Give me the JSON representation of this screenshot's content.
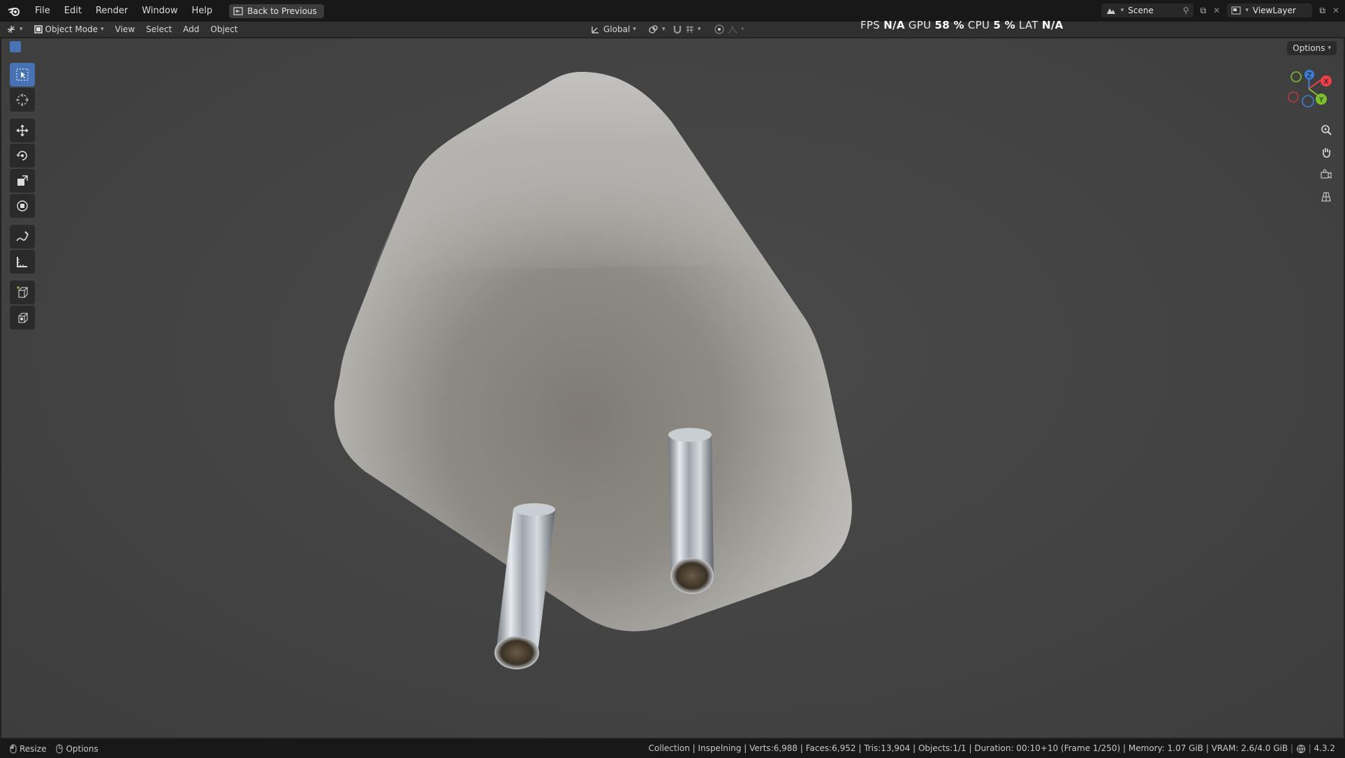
{
  "menubar": {
    "items": [
      "File",
      "Edit",
      "Render",
      "Window",
      "Help"
    ],
    "back_button": "Back to Previous",
    "scene_name": "Scene",
    "view_layer": "ViewLayer"
  },
  "header": {
    "mode": "Object Mode",
    "menus": [
      "View",
      "Select",
      "Add",
      "Object"
    ],
    "orientation": "Global",
    "options_label": "Options",
    "stats": {
      "fps_label": "FPS",
      "fps_value": "N/A",
      "gpu_label": "GPU",
      "gpu_value": "58 %",
      "cpu_label": "CPU",
      "cpu_value": "5 %",
      "lat_label": "LAT",
      "lat_value": "N/A"
    }
  },
  "toolbar": {
    "tools": [
      "select-box-icon",
      "cursor-icon",
      "move-icon",
      "rotate-icon",
      "scale-icon",
      "transform-icon",
      "annotate-icon",
      "measure-icon",
      "add-cube-icon",
      "add-cube-alt-icon"
    ],
    "active_tool": "select-box-icon"
  },
  "gizmo": {
    "axes": [
      "X",
      "Y",
      "Z"
    ],
    "colors": {
      "x": "#e8404a",
      "y": "#7fbf2f",
      "z": "#3a7fd4"
    }
  },
  "statusbar": {
    "left_items": [
      "Resize",
      "Options"
    ],
    "info": "Collection | Inspelning | Verts:6,988 | Faces:6,952 | Tris:13,904 | Objects:1/1 | Duration: 00:10+10 (Frame 1/250) | Memory: 1.07 GiB | VRAM: 2.6/4.0 GiB",
    "version": "4.3.2"
  },
  "colors": {
    "accent": "#4772b3",
    "viewport_bg": "#444444",
    "plug_body": "#bcbab5",
    "pin_metal": "#c4c8cc"
  }
}
